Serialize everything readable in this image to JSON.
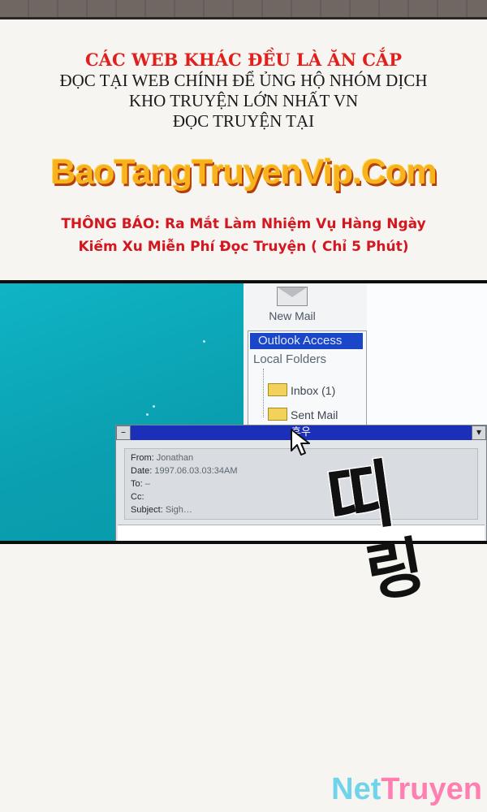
{
  "notice": {
    "line1": "CÁC WEB KHÁC ĐỀU LÀ ĂN CẮP",
    "line2": "ĐỌC TẠI WEB CHÍNH ĐỂ ỦNG HỘ NHÓM DỊCH",
    "line3": "KHO TRUYỆN LỚN NHẤT VN",
    "line4": "ĐỌC TRUYỆN TẠI"
  },
  "brand": "BaoTangTruyenVip.Com",
  "announcement": {
    "prefix": "THÔNG BÁO:",
    "line1_rest": " Ra Mắt Làm Nhiệm Vụ Hàng Ngày",
    "line2": "Kiếm Xu Miễn Phí Đọc Truyện ( Chỉ 5 Phút)"
  },
  "mail_client": {
    "new_mail_label": "New Mail",
    "selected_folder": "Outlook Access",
    "local_folders_label": "Local Folders",
    "folders": [
      "Inbox (1)",
      "Sent Mail"
    ],
    "dialog": {
      "title": "후우",
      "minimize": "–",
      "dropdown": "▾",
      "from_label": "From:",
      "from_value": "Jonathan",
      "date_label": "Date:",
      "date_value": "1997.06.03.03:34AM",
      "to_label": "To:",
      "to_value": "–",
      "cc_label": "Cc:",
      "cc_value": "",
      "subject_label": "Subject:",
      "subject_value": "Sigh…"
    }
  },
  "sfx": {
    "top": "띠",
    "bottom": "링"
  },
  "watermark": {
    "part1": "Net",
    "part2": "Truyen"
  },
  "colors": {
    "red": "#e0201c",
    "brand_orange": "#f7b21c",
    "desktop_teal": "#0aa7b8",
    "title_blue": "#1c2fb8"
  }
}
